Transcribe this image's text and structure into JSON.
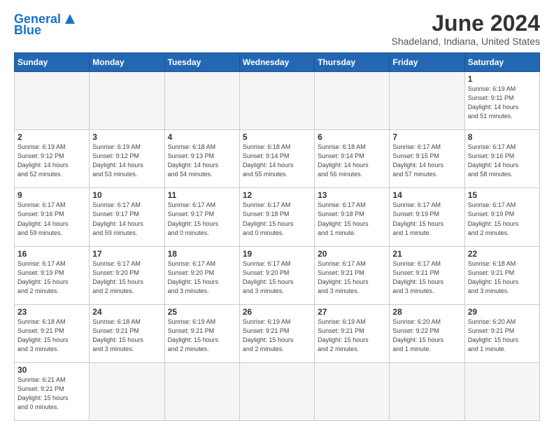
{
  "header": {
    "logo_text_general": "General",
    "logo_text_blue": "Blue",
    "title": "June 2024",
    "subtitle": "Shadeland, Indiana, United States"
  },
  "weekdays": [
    "Sunday",
    "Monday",
    "Tuesday",
    "Wednesday",
    "Thursday",
    "Friday",
    "Saturday"
  ],
  "weeks": [
    [
      {
        "day": "",
        "info": ""
      },
      {
        "day": "",
        "info": ""
      },
      {
        "day": "",
        "info": ""
      },
      {
        "day": "",
        "info": ""
      },
      {
        "day": "",
        "info": ""
      },
      {
        "day": "",
        "info": ""
      },
      {
        "day": "1",
        "info": "Sunrise: 6:19 AM\nSunset: 9:11 PM\nDaylight: 14 hours\nand 51 minutes."
      }
    ],
    [
      {
        "day": "2",
        "info": "Sunrise: 6:19 AM\nSunset: 9:12 PM\nDaylight: 14 hours\nand 52 minutes."
      },
      {
        "day": "3",
        "info": "Sunrise: 6:19 AM\nSunset: 9:12 PM\nDaylight: 14 hours\nand 53 minutes."
      },
      {
        "day": "4",
        "info": "Sunrise: 6:18 AM\nSunset: 9:13 PM\nDaylight: 14 hours\nand 54 minutes."
      },
      {
        "day": "5",
        "info": "Sunrise: 6:18 AM\nSunset: 9:14 PM\nDaylight: 14 hours\nand 55 minutes."
      },
      {
        "day": "6",
        "info": "Sunrise: 6:18 AM\nSunset: 9:14 PM\nDaylight: 14 hours\nand 56 minutes."
      },
      {
        "day": "7",
        "info": "Sunrise: 6:17 AM\nSunset: 9:15 PM\nDaylight: 14 hours\nand 57 minutes."
      },
      {
        "day": "8",
        "info": "Sunrise: 6:17 AM\nSunset: 9:16 PM\nDaylight: 14 hours\nand 58 minutes."
      }
    ],
    [
      {
        "day": "9",
        "info": "Sunrise: 6:17 AM\nSunset: 9:16 PM\nDaylight: 14 hours\nand 59 minutes."
      },
      {
        "day": "10",
        "info": "Sunrise: 6:17 AM\nSunset: 9:17 PM\nDaylight: 14 hours\nand 59 minutes."
      },
      {
        "day": "11",
        "info": "Sunrise: 6:17 AM\nSunset: 9:17 PM\nDaylight: 15 hours\nand 0 minutes."
      },
      {
        "day": "12",
        "info": "Sunrise: 6:17 AM\nSunset: 9:18 PM\nDaylight: 15 hours\nand 0 minutes."
      },
      {
        "day": "13",
        "info": "Sunrise: 6:17 AM\nSunset: 9:18 PM\nDaylight: 15 hours\nand 1 minute."
      },
      {
        "day": "14",
        "info": "Sunrise: 6:17 AM\nSunset: 9:19 PM\nDaylight: 15 hours\nand 1 minute."
      },
      {
        "day": "15",
        "info": "Sunrise: 6:17 AM\nSunset: 9:19 PM\nDaylight: 15 hours\nand 2 minutes."
      }
    ],
    [
      {
        "day": "16",
        "info": "Sunrise: 6:17 AM\nSunset: 9:19 PM\nDaylight: 15 hours\nand 2 minutes."
      },
      {
        "day": "17",
        "info": "Sunrise: 6:17 AM\nSunset: 9:20 PM\nDaylight: 15 hours\nand 2 minutes."
      },
      {
        "day": "18",
        "info": "Sunrise: 6:17 AM\nSunset: 9:20 PM\nDaylight: 15 hours\nand 3 minutes."
      },
      {
        "day": "19",
        "info": "Sunrise: 6:17 AM\nSunset: 9:20 PM\nDaylight: 15 hours\nand 3 minutes."
      },
      {
        "day": "20",
        "info": "Sunrise: 6:17 AM\nSunset: 9:21 PM\nDaylight: 15 hours\nand 3 minutes."
      },
      {
        "day": "21",
        "info": "Sunrise: 6:17 AM\nSunset: 9:21 PM\nDaylight: 15 hours\nand 3 minutes."
      },
      {
        "day": "22",
        "info": "Sunrise: 6:18 AM\nSunset: 9:21 PM\nDaylight: 15 hours\nand 3 minutes."
      }
    ],
    [
      {
        "day": "23",
        "info": "Sunrise: 6:18 AM\nSunset: 9:21 PM\nDaylight: 15 hours\nand 3 minutes."
      },
      {
        "day": "24",
        "info": "Sunrise: 6:18 AM\nSunset: 9:21 PM\nDaylight: 15 hours\nand 3 minutes."
      },
      {
        "day": "25",
        "info": "Sunrise: 6:19 AM\nSunset: 9:21 PM\nDaylight: 15 hours\nand 2 minutes."
      },
      {
        "day": "26",
        "info": "Sunrise: 6:19 AM\nSunset: 9:21 PM\nDaylight: 15 hours\nand 2 minutes."
      },
      {
        "day": "27",
        "info": "Sunrise: 6:19 AM\nSunset: 9:21 PM\nDaylight: 15 hours\nand 2 minutes."
      },
      {
        "day": "28",
        "info": "Sunrise: 6:20 AM\nSunset: 9:22 PM\nDaylight: 15 hours\nand 1 minute."
      },
      {
        "day": "29",
        "info": "Sunrise: 6:20 AM\nSunset: 9:21 PM\nDaylight: 15 hours\nand 1 minute."
      }
    ],
    [
      {
        "day": "30",
        "info": "Sunrise: 6:21 AM\nSunset: 9:21 PM\nDaylight: 15 hours\nand 0 minutes."
      },
      {
        "day": "",
        "info": ""
      },
      {
        "day": "",
        "info": ""
      },
      {
        "day": "",
        "info": ""
      },
      {
        "day": "",
        "info": ""
      },
      {
        "day": "",
        "info": ""
      },
      {
        "day": "",
        "info": ""
      }
    ]
  ]
}
